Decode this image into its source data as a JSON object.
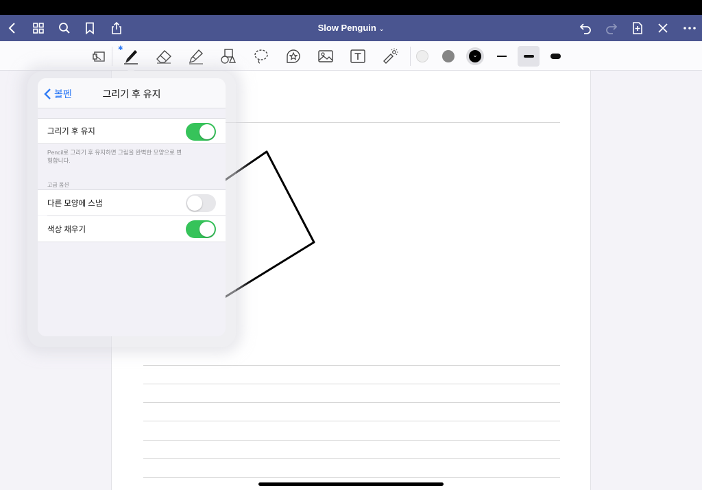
{
  "navbar": {
    "title": "Slow Penguin",
    "icons": [
      "back-chevron-icon",
      "grid-icon",
      "search-icon",
      "bookmark-icon",
      "share-icon",
      "undo-icon",
      "redo-icon",
      "add-page-icon",
      "close-icon",
      "more-icon"
    ]
  },
  "toolbar": {
    "tools": [
      "lasso-select-icon",
      "pen-icon",
      "eraser-icon",
      "highlighter-icon",
      "shapes-icon",
      "lasso-icon",
      "sticker-icon",
      "image-icon",
      "text-icon",
      "laser-pointer-icon"
    ],
    "colors": {
      "swatch1": "#eeeeee",
      "swatch2": "#858585",
      "swatch3": "#000000"
    },
    "selected_width": "thick"
  },
  "popover": {
    "back_label": "볼펜",
    "title": "그리기 후 유지",
    "rows": [
      {
        "label": "그리기 후 유지",
        "enabled": true
      },
      {
        "label": "다른 모양에 스냅",
        "enabled": false
      },
      {
        "label": "색상 채우기",
        "enabled": true
      }
    ],
    "footnote": "Pencil로 그리기 후 유지하면 그림을 완벽한 모양으로 변형합니다.",
    "section_header": "고급 옵션"
  },
  "colors": {
    "navbar": "#4a5590",
    "accent": "#2f7bf5",
    "toggle_on": "#36c35a"
  }
}
